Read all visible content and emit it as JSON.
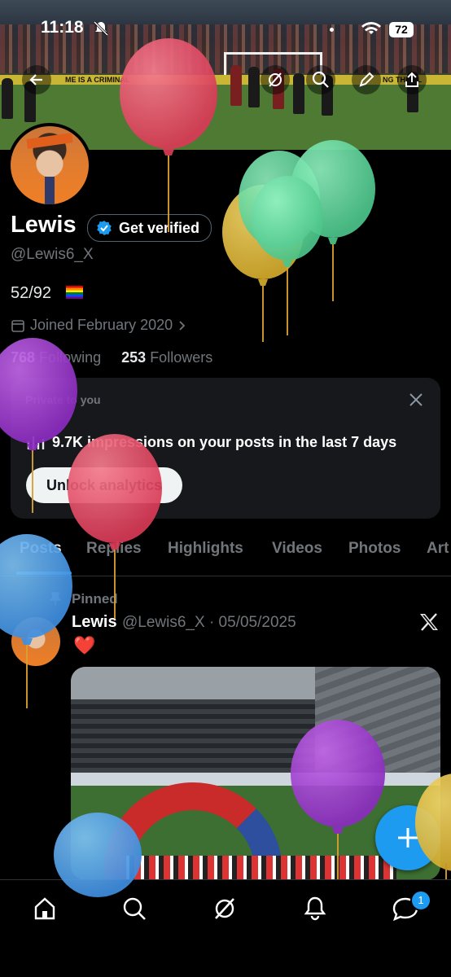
{
  "status": {
    "time": "11:18",
    "battery": "72"
  },
  "banner": {
    "ad_left": "ME IS A CRIMINAL",
    "ad_right": "NG THE PL"
  },
  "profile": {
    "name": "Lewis",
    "verify_label": "Get verified",
    "handle": "@Lewis6_X",
    "bio": "52/92",
    "joined": "Joined February 2020",
    "following_count": "768",
    "following_label": "Following",
    "followers_count": "253",
    "followers_label": "Followers"
  },
  "analytics_card": {
    "private_label": "Private to you",
    "impressions_text": "9.7K impressions on your posts in the last 7 days",
    "unlock_label": "Unlock analytics"
  },
  "tabs": [
    "Posts",
    "Replies",
    "Highlights",
    "Videos",
    "Photos",
    "Art"
  ],
  "post": {
    "pinned_label": "Pinned",
    "author": "Lewis",
    "meta": "@Lewis6_X · 05/05/2025",
    "text": "❤️"
  },
  "nav": {
    "messages_badge": "1"
  },
  "colors": {
    "accent": "#1d9bf0",
    "background": "#000000",
    "card": "#16181c"
  },
  "icons": [
    "back-icon",
    "no-bell-icon",
    "wifi-icon",
    "grok-icon",
    "search-icon",
    "edit-icon",
    "share-icon",
    "verified-badge-icon",
    "calendar-icon",
    "chevron-right-icon",
    "close-icon",
    "chart-icon",
    "pin-icon",
    "x-logo-icon",
    "plus-icon",
    "home-icon",
    "explore-icon",
    "grok-nav-icon",
    "notifications-icon",
    "messages-icon",
    "balloon"
  ]
}
